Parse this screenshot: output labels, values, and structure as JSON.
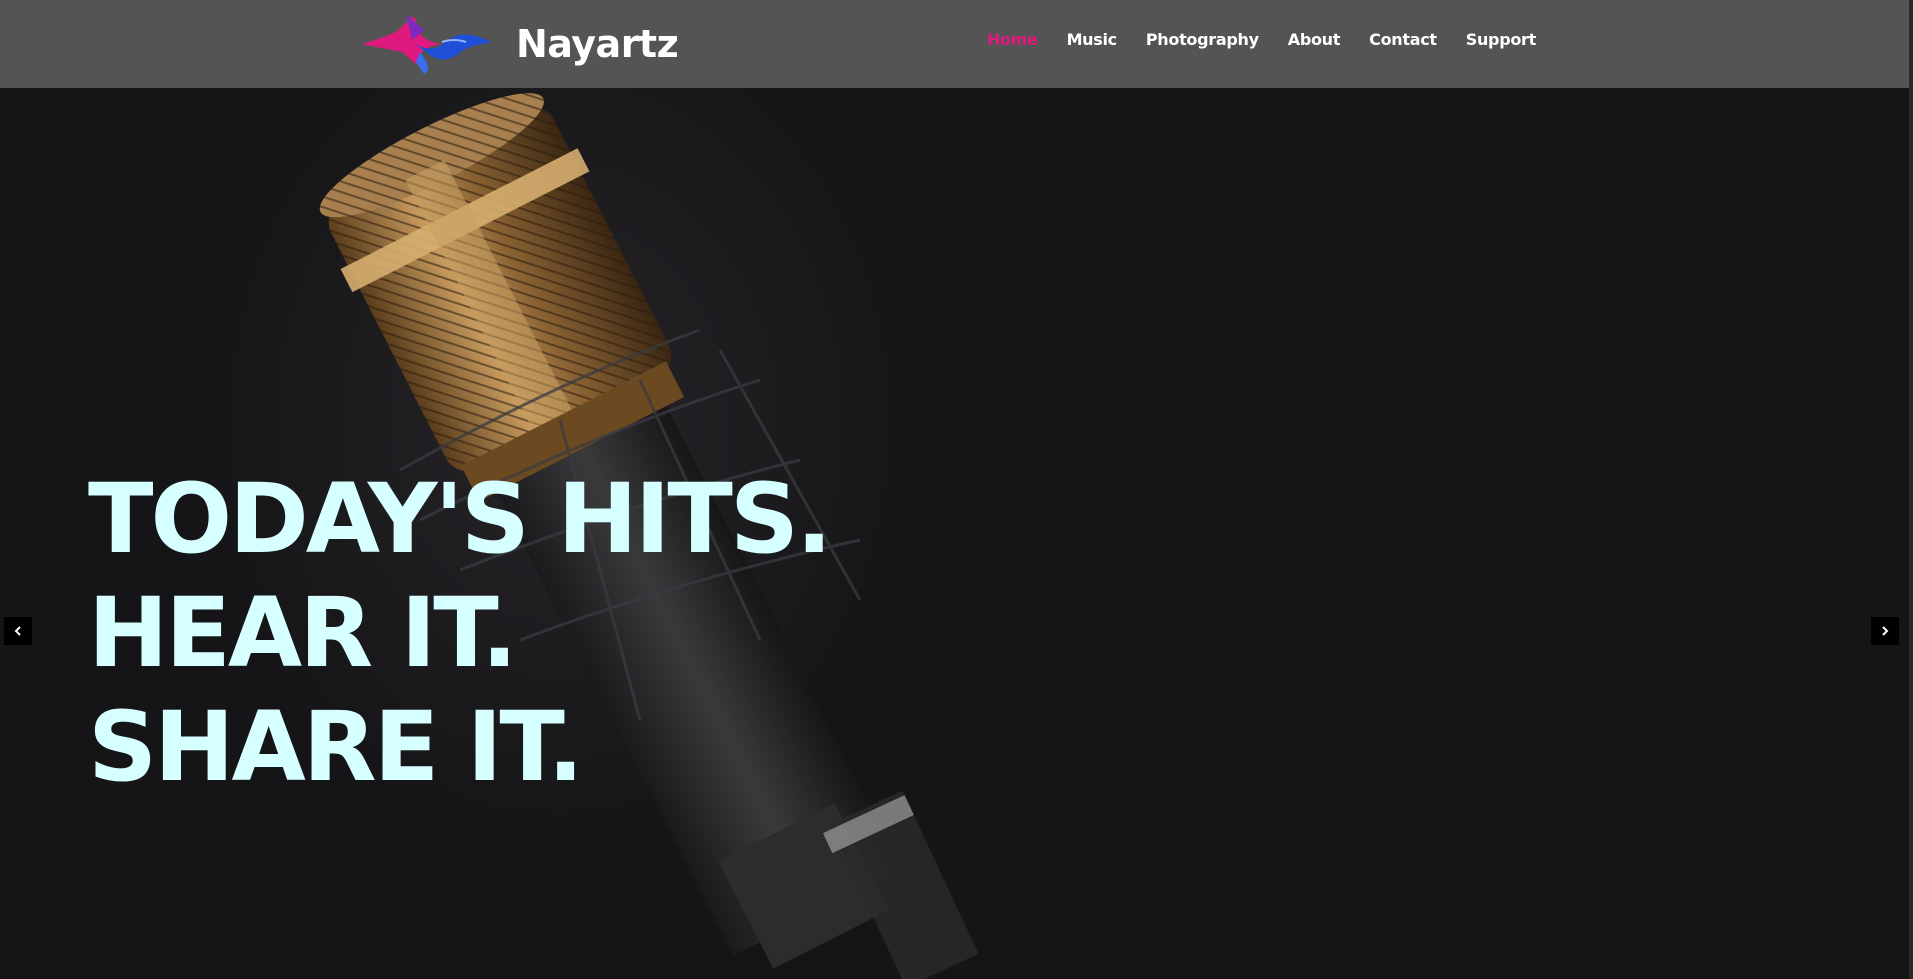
{
  "header": {
    "brand_name": "Nayartz",
    "logo_icon": "wave-logo-icon",
    "nav": [
      {
        "label": "Home",
        "active": true
      },
      {
        "label": "Music",
        "active": false
      },
      {
        "label": "Photography",
        "active": false
      },
      {
        "label": "About",
        "active": false
      },
      {
        "label": "Contact",
        "active": false
      },
      {
        "label": "Support",
        "active": false
      }
    ]
  },
  "hero": {
    "background_image": "microphone-photo",
    "headline_lines": [
      "TODAY'S HITS.",
      "HEAR IT.",
      "SHARE IT."
    ],
    "prev_icon": "chevron-left-icon",
    "next_icon": "chevron-right-icon"
  },
  "colors": {
    "header_bg": "#545454",
    "active_nav": "#e0197e",
    "headline": "#d6ffff",
    "hero_bg": "#151416"
  }
}
